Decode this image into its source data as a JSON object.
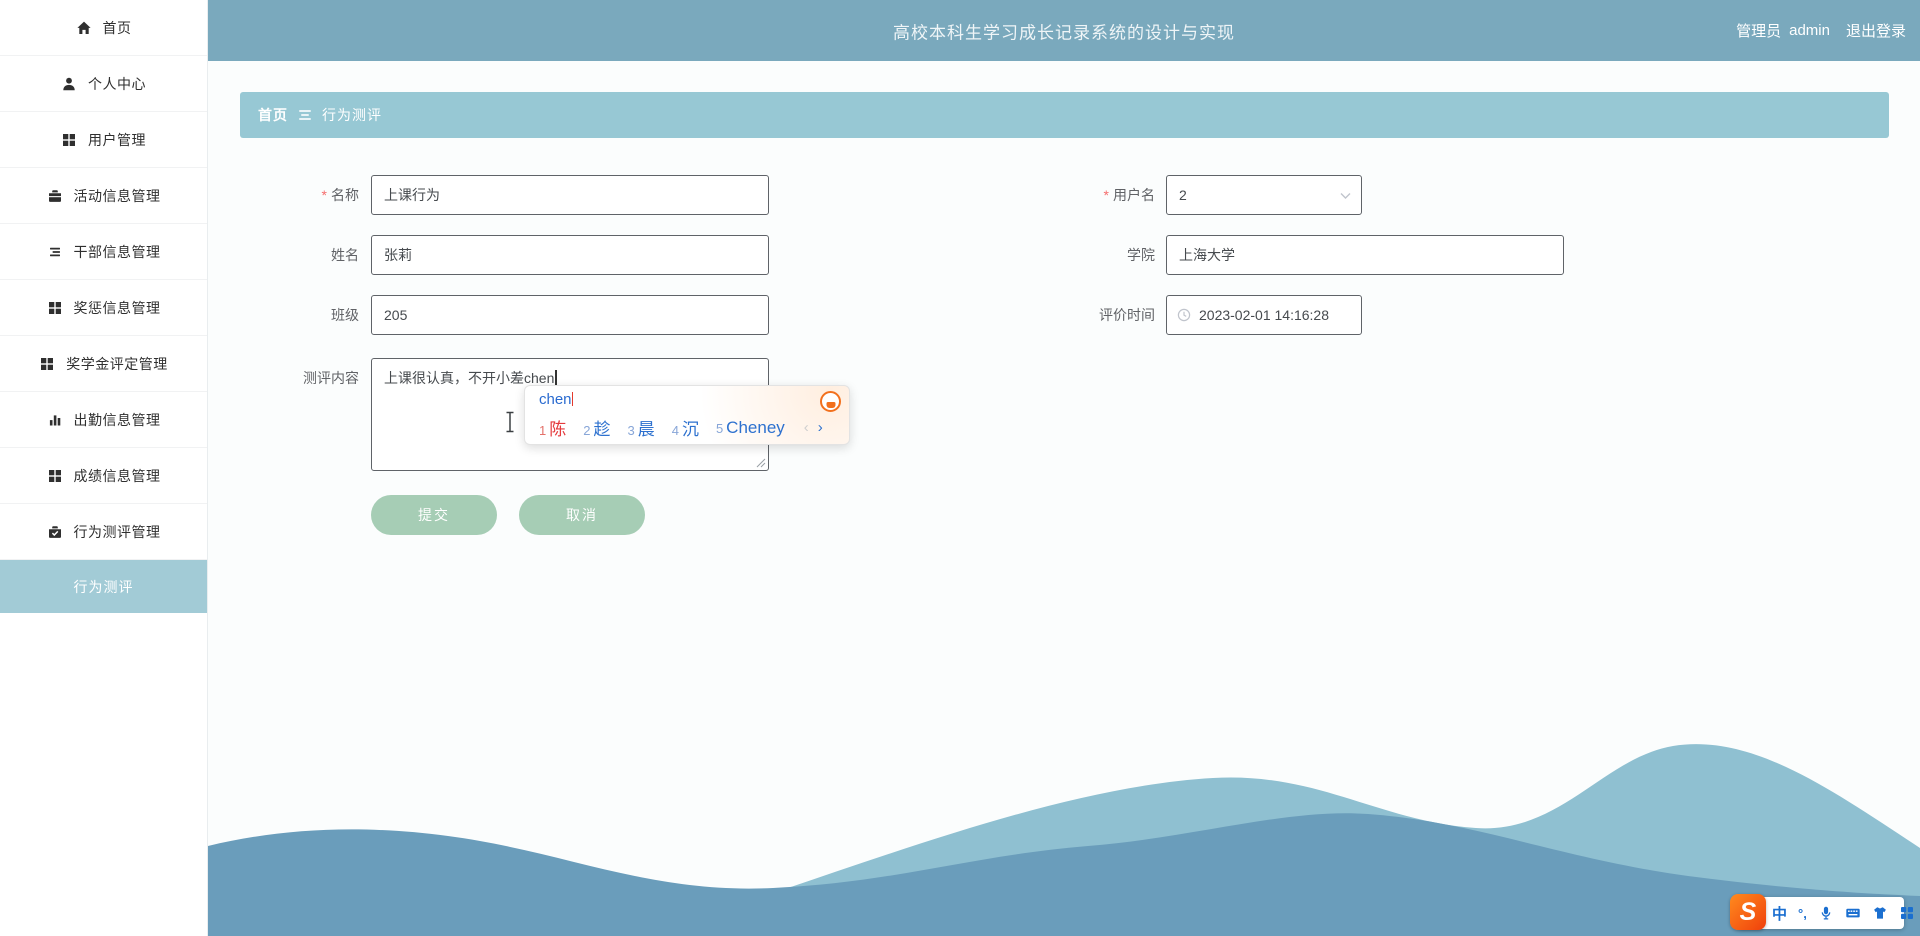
{
  "app": {
    "title": "高校本科生学习成长记录系统的设计与实现"
  },
  "header": {
    "role_label": "管理员",
    "username": "admin",
    "logout_label": "退出登录"
  },
  "sidebar": {
    "items": [
      {
        "label": "首页",
        "icon": "home-icon"
      },
      {
        "label": "个人中心",
        "icon": "user-icon"
      },
      {
        "label": "用户管理",
        "icon": "grid-icon"
      },
      {
        "label": "活动信息管理",
        "icon": "briefcase-icon"
      },
      {
        "label": "干部信息管理",
        "icon": "list-icon"
      },
      {
        "label": "奖惩信息管理",
        "icon": "grid-icon"
      },
      {
        "label": "奖学金评定管理",
        "icon": "grid-icon"
      },
      {
        "label": "出勤信息管理",
        "icon": "bar-chart-icon"
      },
      {
        "label": "成绩信息管理",
        "icon": "grid-icon"
      },
      {
        "label": "行为测评管理",
        "icon": "briefcase-check-icon"
      }
    ],
    "active_item": {
      "label": "行为测评"
    }
  },
  "breadcrumb": {
    "home": "首页",
    "current": "行为测评"
  },
  "form": {
    "required_mark": "*",
    "name": {
      "label": "名称",
      "value": "上课行为"
    },
    "username": {
      "label": "用户名",
      "value": "2"
    },
    "person_name": {
      "label": "姓名",
      "value": "张莉"
    },
    "college": {
      "label": "学院",
      "value": "上海大学"
    },
    "clazz": {
      "label": "班级",
      "value": "205"
    },
    "eval_time": {
      "label": "评价时间",
      "value": "2023-02-01 14:16:28"
    },
    "content": {
      "label": "测评内容",
      "value": "上课很认真，不开小差chen"
    },
    "submit_label": "提交",
    "cancel_label": "取消"
  },
  "ime": {
    "composition": "chen",
    "candidates": [
      {
        "num": "1",
        "text": "陈"
      },
      {
        "num": "2",
        "text": "趁"
      },
      {
        "num": "3",
        "text": "晨"
      },
      {
        "num": "4",
        "text": "沉"
      },
      {
        "num": "5",
        "text": "Cheney"
      }
    ],
    "prev_arrow": "‹",
    "next_arrow": "›"
  },
  "ime_toolbar": {
    "logo": "S",
    "lang": "中",
    "punct": "°,"
  },
  "colors": {
    "header_bg": "#7aa9bd",
    "breadcrumb_bg": "#97c8d4",
    "active_menu_bg": "#a2cbd6",
    "button_bg": "#a6cdb5",
    "wave_front": "#6a9dbb",
    "wave_back": "#8fc0d1",
    "candidate_first": "#e4393c",
    "candidate_blue": "#2d71cf",
    "required_red": "#f56c6c"
  }
}
